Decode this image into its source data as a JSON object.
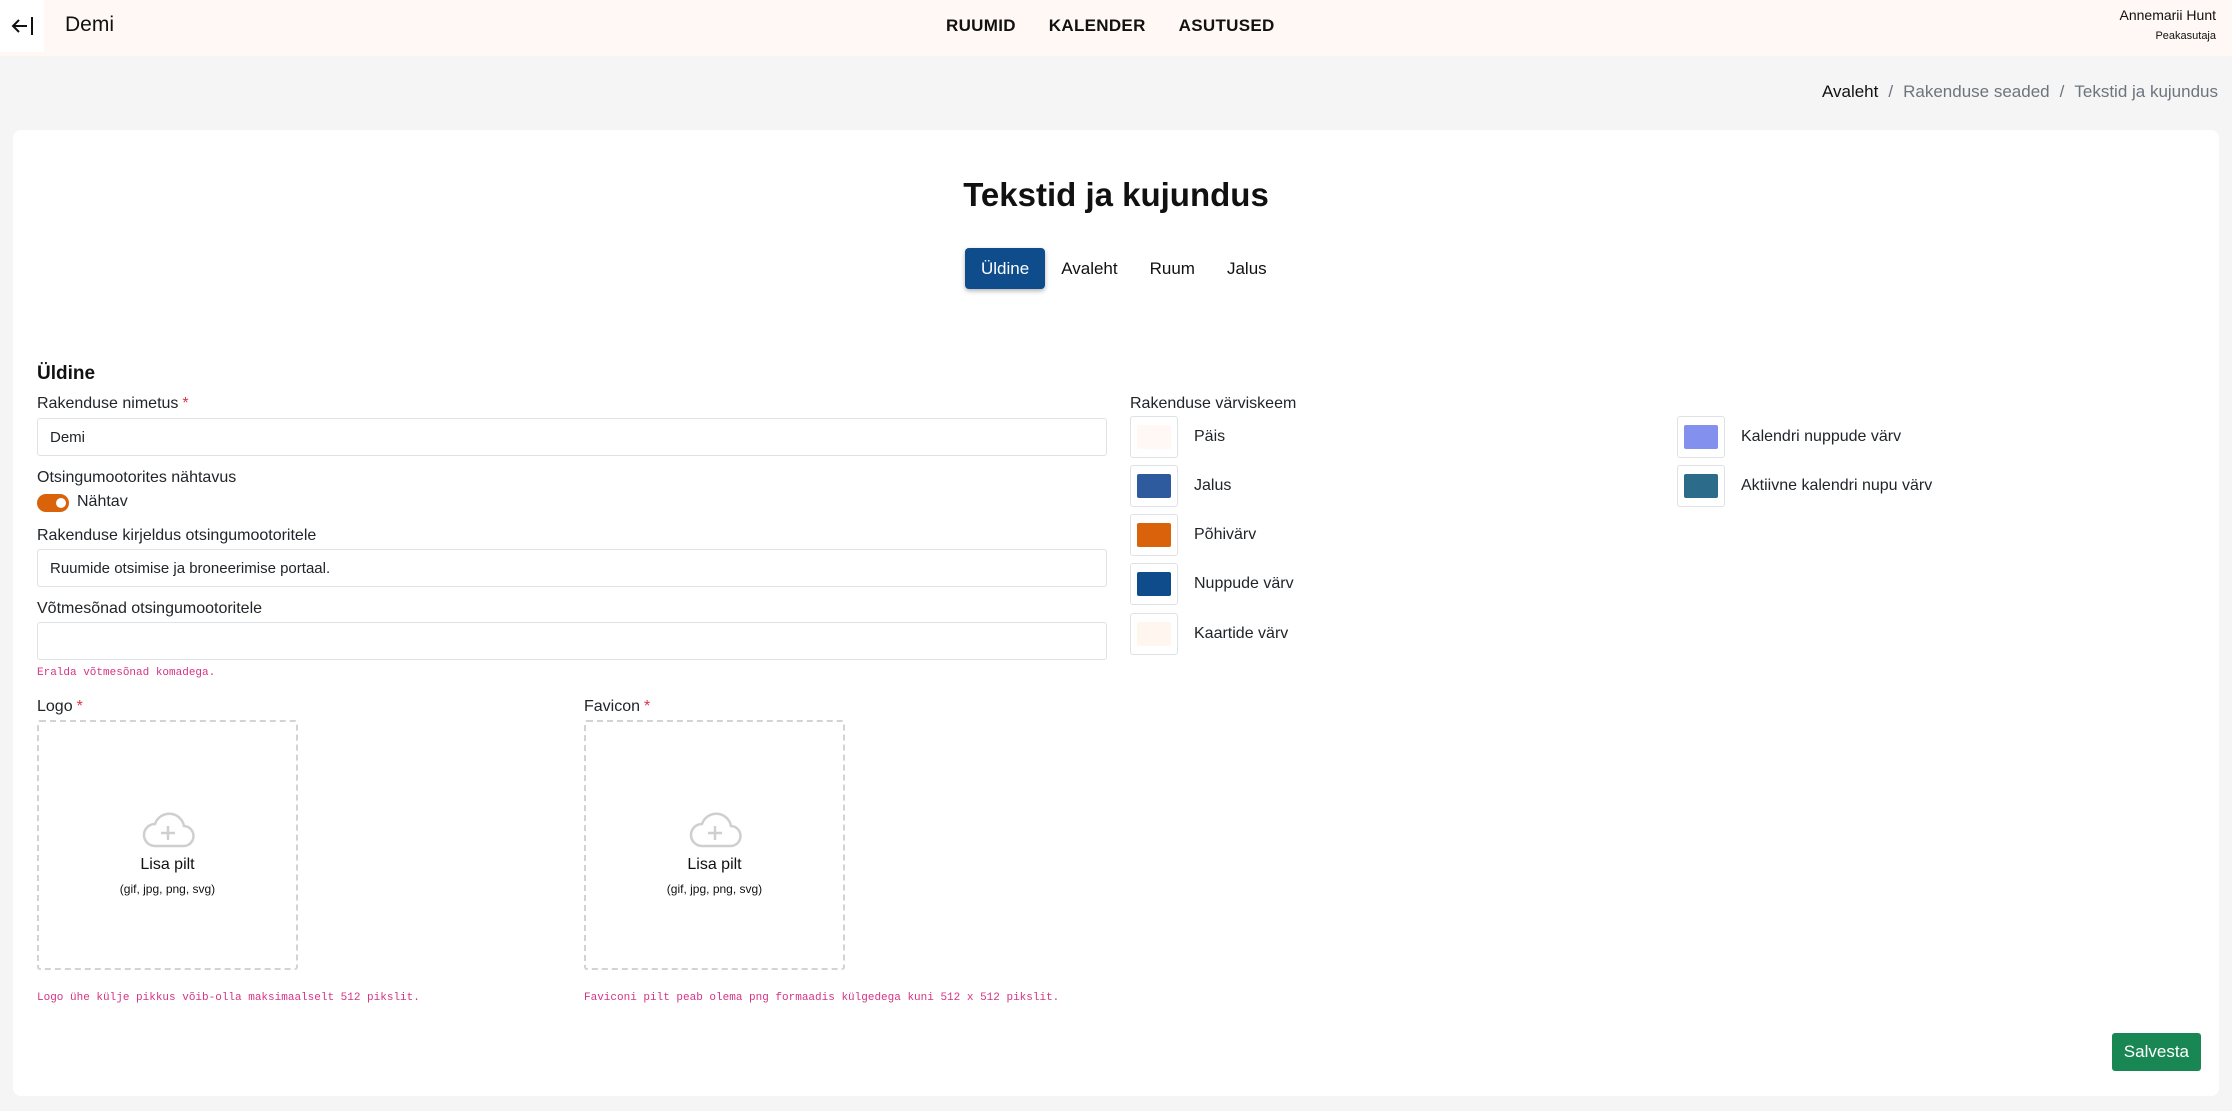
{
  "header": {
    "app_name": "Demi",
    "nav": [
      "RUUMID",
      "KALENDER",
      "ASUTUSED"
    ],
    "user_name": "Annemarii Hunt",
    "user_role": "Peakasutaja"
  },
  "breadcrumb": {
    "home": "Avaleht",
    "settings": "Rakenduse seaded",
    "current": "Tekstid ja kujundus"
  },
  "page": {
    "title": "Tekstid ja kujundus",
    "tabs": [
      "Üldine",
      "Avaleht",
      "Ruum",
      "Jalus"
    ],
    "active_tab": "Üldine"
  },
  "form": {
    "section_title": "Üldine",
    "app_name_label": "Rakenduse nimetus",
    "app_name_value": "Demi",
    "seo_visibility_label": "Otsingumootorites nähtavus",
    "seo_visibility_toggle": "Nähtav",
    "seo_description_label": "Rakenduse kirjeldus otsingumootoritele",
    "seo_description_value": "Ruumide otsimise ja broneerimise portaal.",
    "keywords_label": "Võtmesõnad otsingumootoritele",
    "keywords_value": "",
    "keywords_hint": "Eralda võtmesõnad komadega.",
    "logo_label": "Logo",
    "logo_upload_label": "Lisa pilt",
    "logo_upload_formats": "(gif, jpg, png, svg)",
    "logo_hint": "Logo ühe külje pikkus võib-olla maksimaalselt 512 pikslit.",
    "favicon_label": "Favicon",
    "favicon_upload_label": "Lisa pilt",
    "favicon_upload_formats": "(gif, jpg, png, svg)",
    "favicon_hint": "Faviconi pilt peab olema png formaadis külgedega kuni 512 x 512 pikslit.",
    "required_mark": "*"
  },
  "colors": {
    "title": "Rakenduse värviskeem",
    "items": [
      {
        "label": "Päis",
        "color": "#fff8f4"
      },
      {
        "label": "Jalus",
        "color": "#2e5a9e"
      },
      {
        "label": "Põhivärv",
        "color": "#d9620a"
      },
      {
        "label": "Nuppude värv",
        "color": "#0e4c8c"
      },
      {
        "label": "Kaartide värv",
        "color": "#fff6f0"
      },
      {
        "label": "Kalendri nuppude värv",
        "color": "#8490ee"
      },
      {
        "label": "Aktiivne kalendri nupu värv",
        "color": "#2d6b8a"
      }
    ]
  },
  "actions": {
    "save": "Salvesta"
  }
}
